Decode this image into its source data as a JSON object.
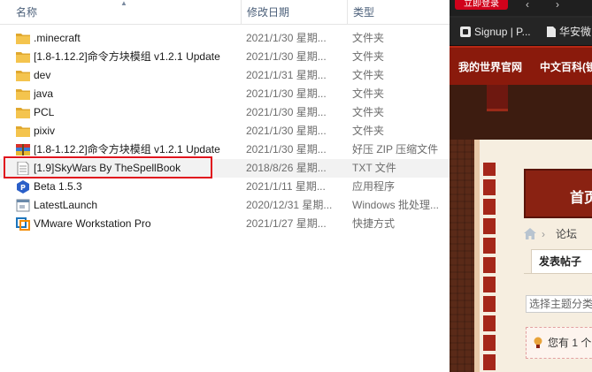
{
  "explorer": {
    "columns": {
      "name": "名称",
      "date": "修改日期",
      "type": "类型"
    },
    "rows": [
      {
        "name": ".minecraft",
        "date": "2021/1/30 星期...",
        "type": "文件夹",
        "icon": "folder-icon"
      },
      {
        "name": "[1.8-1.12.2]命令方块模组 v1.2.1 Update",
        "date": "2021/1/30 星期...",
        "type": "文件夹",
        "icon": "folder-icon"
      },
      {
        "name": "dev",
        "date": "2021/1/31 星期...",
        "type": "文件夹",
        "icon": "folder-icon"
      },
      {
        "name": "java",
        "date": "2021/1/30 星期...",
        "type": "文件夹",
        "icon": "folder-icon"
      },
      {
        "name": "PCL",
        "date": "2021/1/30 星期...",
        "type": "文件夹",
        "icon": "folder-icon"
      },
      {
        "name": "pixiv",
        "date": "2021/1/30 星期...",
        "type": "文件夹",
        "icon": "folder-icon"
      },
      {
        "name": "[1.8-1.12.2]命令方块模组 v1.2.1 Update",
        "date": "2021/1/30 星期...",
        "type": "好压 ZIP 压缩文件",
        "icon": "zip-archive-icon"
      },
      {
        "name": "[1.9]SkyWars By TheSpellBook",
        "date": "2018/8/26 星期...",
        "type": "TXT 文件",
        "icon": "text-file-icon"
      },
      {
        "name": "Beta 1.5.3",
        "date": "2021/1/11 星期...",
        "type": "应用程序",
        "icon": "app-exe-icon"
      },
      {
        "name": "LatestLaunch",
        "date": "2020/12/31 星期...",
        "type": "Windows 批处理...",
        "icon": "batch-file-icon"
      },
      {
        "name": "VMware Workstation Pro",
        "date": "2021/1/27 星期...",
        "type": "快捷方式",
        "icon": "vmware-shortcut-icon"
      }
    ],
    "highlighted_row": 7
  },
  "browser": {
    "login_button": "立即登录",
    "bookmarks": [
      "Signup | P...",
      "华安微"
    ],
    "nav": [
      "我的世界官网",
      "中文百科(镜"
    ],
    "home_banner": "首页",
    "breadcrumb_forum": "论坛",
    "breadcrumb_sep": "›",
    "post_tab": "发表帖子",
    "topic_select": "选择主题分类",
    "notice_text": "您有 1 个",
    "colors": {
      "nav_bar": "#8a1a0c",
      "login_button": "#d0021b",
      "highlight_box": "#e0141e"
    }
  }
}
